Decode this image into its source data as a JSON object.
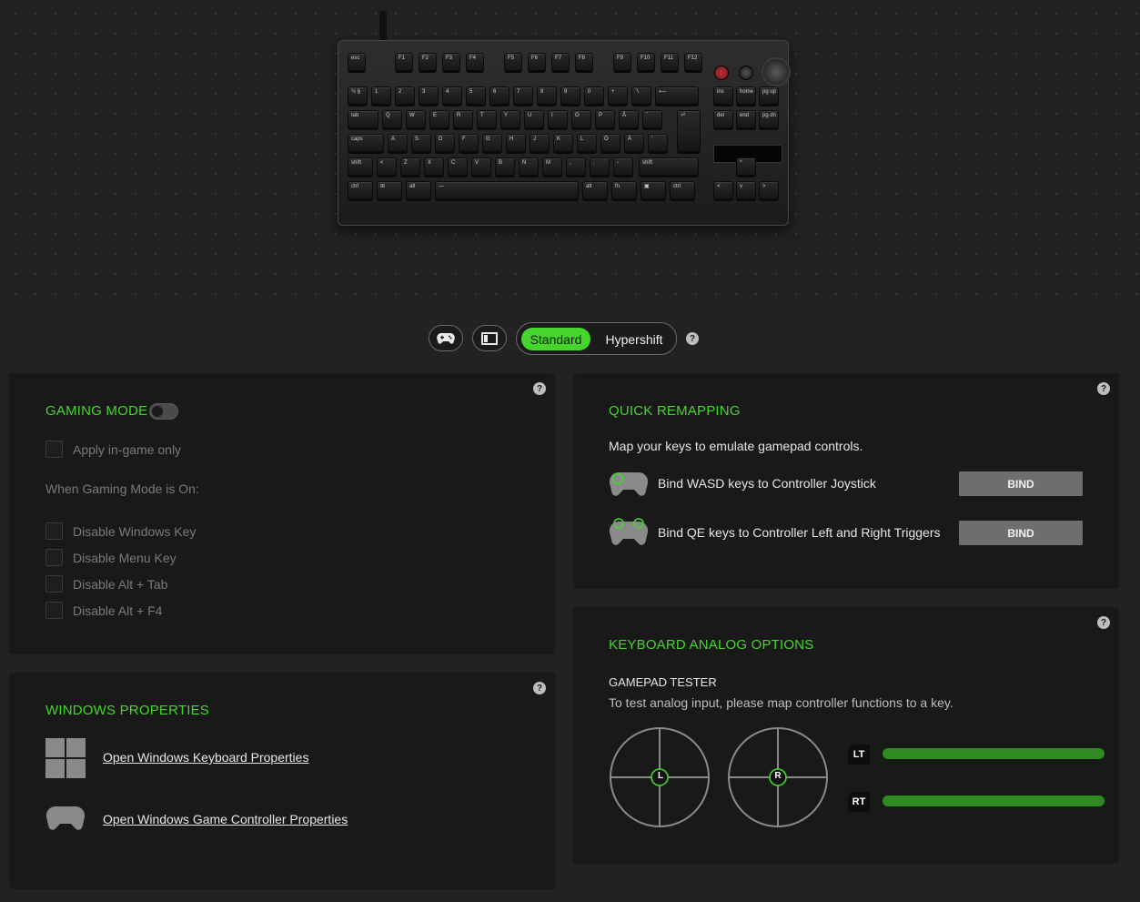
{
  "keyboard": {
    "row_fn": [
      "esc",
      "F1",
      "F2",
      "F3",
      "F4",
      "F5",
      "F6",
      "F7",
      "F8",
      "F9",
      "F10",
      "F11",
      "F12"
    ],
    "row_num": [
      "½ §",
      "1",
      "2",
      "3",
      "4",
      "5",
      "6",
      "7",
      "8",
      "9",
      "0",
      "+",
      "`\\",
      "⟵",
      "ins",
      "home",
      "pg up"
    ],
    "row_tab": [
      "tab",
      "Q",
      "W",
      "E",
      "R",
      "T",
      "Y",
      "U",
      "I",
      "O",
      "P",
      "Å",
      "¨",
      "del",
      "end",
      "pg dn"
    ],
    "row_caps": [
      "caps",
      "A",
      "S",
      "D",
      "F",
      "G",
      "H",
      "J",
      "K",
      "L",
      "Ö",
      "Ä",
      "'"
    ],
    "row_shift": [
      "shift",
      "<",
      "Z",
      "X",
      "C",
      "V",
      "B",
      "N",
      "M",
      ",",
      ".",
      "-",
      "shift",
      "^"
    ],
    "row_ctrl": [
      "ctrl",
      "⊞",
      "alt",
      "—",
      "alt",
      "fn",
      "▣",
      "ctrl",
      "<",
      "v",
      ">"
    ]
  },
  "modebar": {
    "gamepad_icon": "gamepad-icon",
    "panel_icon": "panel-icon",
    "standard_label": "Standard",
    "hypershift_label": "Hypershift",
    "help": "?"
  },
  "gaming_mode": {
    "title": "GAMING MODE",
    "toggle_on": false,
    "apply_ingame_label": "Apply in-game only",
    "when_on_label": "When Gaming Mode is On:",
    "options": [
      {
        "label": "Disable Windows Key"
      },
      {
        "label": "Disable Menu Key"
      },
      {
        "label": "Disable Alt + Tab"
      },
      {
        "label": "Disable Alt + F4"
      }
    ],
    "help": "?"
  },
  "windows_properties": {
    "title": "WINDOWS PROPERTIES",
    "keyboard_link": "Open Windows Keyboard Properties",
    "controller_link": "Open Windows Game Controller Properties",
    "help": "?"
  },
  "quick_remapping": {
    "title": "QUICK REMAPPING",
    "description": "Map your keys to emulate gamepad controls.",
    "items": [
      {
        "label": "Bind WASD keys to Controller Joystick",
        "button": "BIND"
      },
      {
        "label": "Bind QE keys to Controller Left and Right Triggers",
        "button": "BIND"
      }
    ],
    "help": "?"
  },
  "analog_options": {
    "title": "KEYBOARD ANALOG OPTIONS",
    "tester_title": "GAMEPAD TESTER",
    "tester_desc": "To test analog input, please map controller functions to a key.",
    "left_stick": "L",
    "right_stick": "R",
    "triggers": [
      {
        "label": "LT",
        "value": 1.0
      },
      {
        "label": "RT",
        "value": 1.0
      }
    ],
    "help": "?"
  },
  "colors": {
    "accent": "#44d62c",
    "panel_bg": "#191919",
    "page_bg": "#222222",
    "bar_fill": "#2f8a21",
    "button_bg": "#6e6e6e"
  }
}
